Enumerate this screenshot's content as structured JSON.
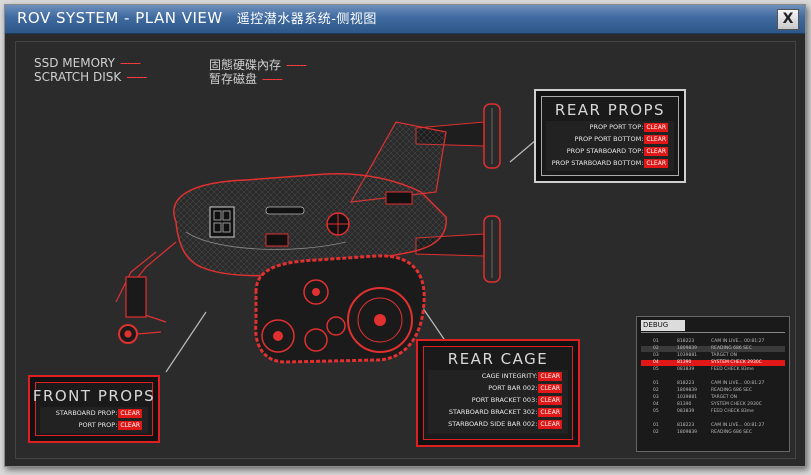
{
  "window": {
    "title": "ROV SYSTEM - PLAN VIEW",
    "title_cn": "遥控潜水器系统-侧视图",
    "close_label": "X"
  },
  "memory": {
    "ssd": "SSD MEMORY",
    "scratch": "SCRATCH DISK",
    "ssd_cn": "固態硬碟內存",
    "scratch_cn": "暂存磁盘",
    "dash": "------"
  },
  "rear_props": {
    "title": "REAR PROPS",
    "rows": [
      {
        "label": "PROP PORT TOP:",
        "status": "CLEAR"
      },
      {
        "label": "PROP PORT BOTTOM:",
        "status": "CLEAR"
      },
      {
        "label": "PROP STARBOARD TOP:",
        "status": "CLEAR"
      },
      {
        "label": "PROP STARBOARD BOTTOM:",
        "status": "CLEAR"
      }
    ]
  },
  "front_props": {
    "title": "FRONT PROPS",
    "rows": [
      {
        "label": "STARBOARD PROP:",
        "status": "CLEAR"
      },
      {
        "label": "PORT PROP:",
        "status": "CLEAR"
      }
    ]
  },
  "rear_cage": {
    "title": "REAR CAGE",
    "rows": [
      {
        "label": "CAGE INTEGRITY:",
        "status": "CLEAR"
      },
      {
        "label": "PORT BAR 002:",
        "status": "CLEAR"
      },
      {
        "label": "PORT BRACKET 003:",
        "status": "CLEAR"
      },
      {
        "label": "STARBOARD BRACKET 302:",
        "status": "CLEAR"
      },
      {
        "label": "STARBOARD SIDE BAR 002:",
        "status": "CLEAR"
      }
    ]
  },
  "debug": {
    "title": "DEBUG",
    "rows": [
      {
        "id": "01",
        "code": "818223",
        "msg": "CAM IN LIVE... 00:81:27",
        "style": ""
      },
      {
        "id": "02",
        "code": "1809839",
        "msg": "READING 686 SEC",
        "style": "shade"
      },
      {
        "id": "03",
        "code": "1039881",
        "msg": "TARGET ON",
        "style": ""
      },
      {
        "id": "04",
        "code": "81390",
        "msg": "SYSTEM CHECK 2930C",
        "style": "hl"
      },
      {
        "id": "05",
        "code": "083839",
        "msg": "FEED CHECK 83me",
        "style": ""
      },
      {
        "id": "",
        "code": "",
        "msg": "",
        "style": ""
      },
      {
        "id": "01",
        "code": "818223",
        "msg": "CAM IN LIVE... 00:81:27",
        "style": ""
      },
      {
        "id": "02",
        "code": "1809839",
        "msg": "READING 686 SEC",
        "style": ""
      },
      {
        "id": "03",
        "code": "1039881",
        "msg": "TARGET ON",
        "style": ""
      },
      {
        "id": "04",
        "code": "81390",
        "msg": "SYSTEM CHECK 2930C",
        "style": ""
      },
      {
        "id": "05",
        "code": "083839",
        "msg": "FEED CHECK 83me",
        "style": ""
      },
      {
        "id": "",
        "code": "",
        "msg": "",
        "style": ""
      },
      {
        "id": "01",
        "code": "818223",
        "msg": "CAM IN LIVE... 00:81:27",
        "style": ""
      },
      {
        "id": "02",
        "code": "1809839",
        "msg": "READING 686 SEC",
        "style": ""
      }
    ]
  },
  "colors": {
    "accent": "#e01818",
    "titlebar": "#3f6a9f",
    "background": "#2a2a2a"
  }
}
